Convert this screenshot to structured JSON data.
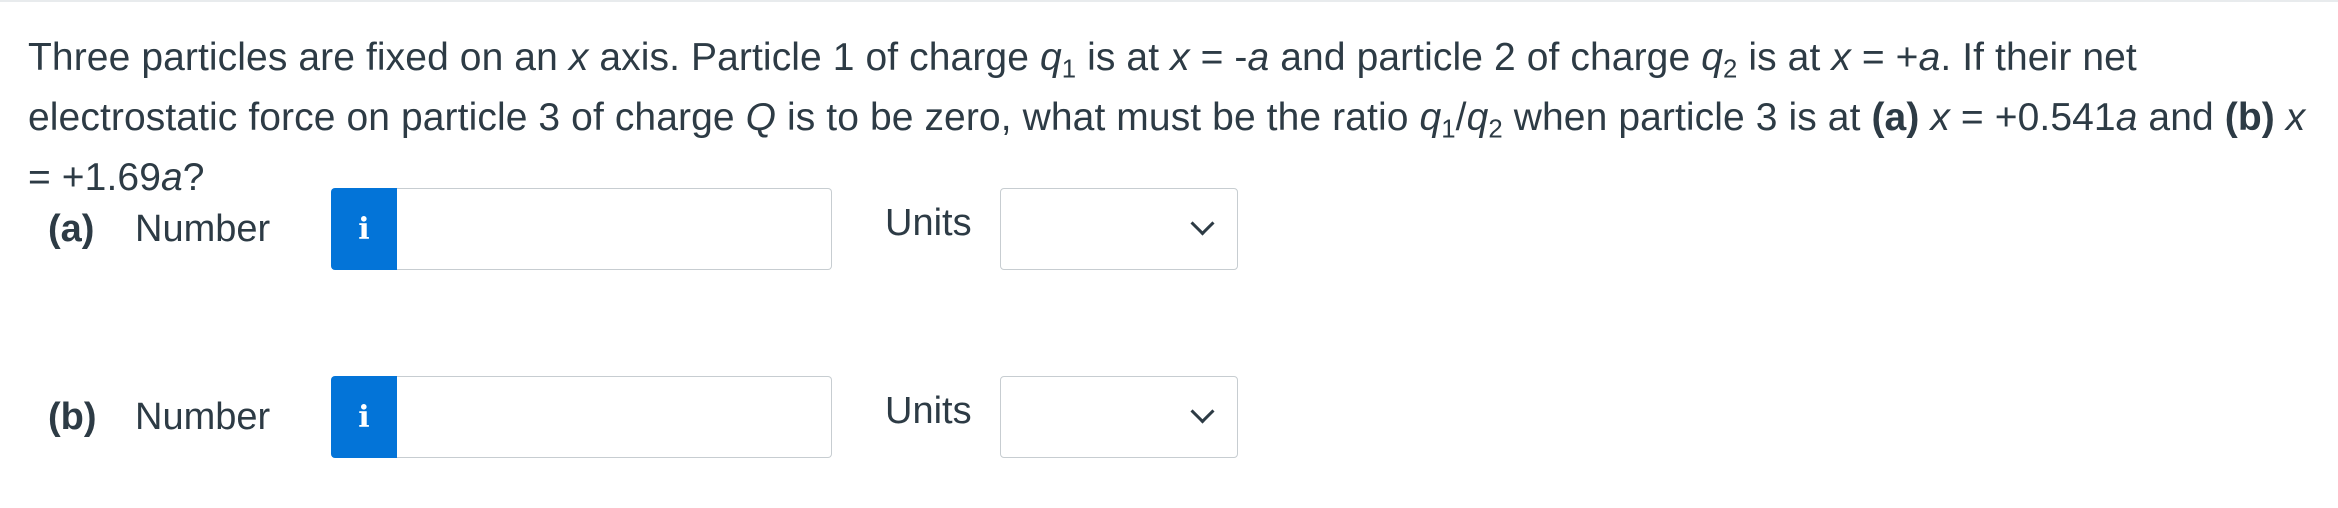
{
  "question": {
    "t1": "Three particles are fixed on an ",
    "x": "x",
    "t2": " axis. Particle 1 of charge ",
    "q": "q",
    "sub1": "1",
    "t3": " is at ",
    "t4": " = -",
    "a": "a",
    "t5": " and particle 2 of charge ",
    "sub2": "2",
    "t6": " = +",
    "t7": ". If their net electrostatic force on particle 3 of charge ",
    "Q": "Q",
    "t8": " is to be zero, what must be the ratio ",
    "slash": "/",
    "t9": " when particle 3 is at ",
    "pa": "(a)",
    "t10": " = +0.541",
    "t11": " and ",
    "pb": "(b)",
    "t12": " = +1.69",
    "t13": "?"
  },
  "parts": [
    {
      "label": "(a)",
      "number_label": "Number",
      "info_icon": "i",
      "input_value": "",
      "units_label": "Units",
      "units_selected": ""
    },
    {
      "label": "(b)",
      "number_label": "Number",
      "info_icon": "i",
      "input_value": "",
      "units_label": "Units",
      "units_selected": ""
    }
  ],
  "colors": {
    "text": "#2d3b45",
    "info_button": "#0374d8",
    "border": "#c7cdd1"
  }
}
